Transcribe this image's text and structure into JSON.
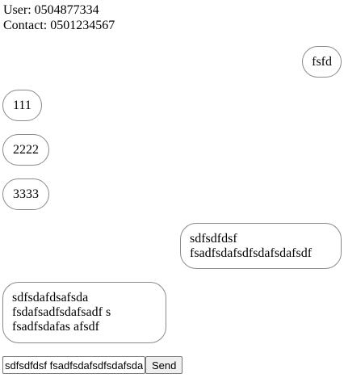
{
  "header": {
    "user_line": "User: 0504877334",
    "contact_line": "Contact: 0501234567"
  },
  "messages": [
    {
      "side": "right",
      "lines": [
        "fsfd"
      ]
    },
    {
      "side": "left",
      "lines": [
        "111"
      ]
    },
    {
      "side": "left",
      "lines": [
        "2222"
      ]
    },
    {
      "side": "left",
      "lines": [
        "3333"
      ]
    },
    {
      "side": "right",
      "lines": [
        "sdfsdfdsf",
        "fsadfsdafsdfsdafsdafsdf"
      ]
    },
    {
      "side": "left",
      "lines": [
        "sdfsdafdsafsda",
        "fsdafsadfsdafsadf s",
        "fsadfsdafas afsdf"
      ]
    }
  ],
  "composer": {
    "input_value": "sdfsdfdsf fsadfsdafsdfsdafsdafsdf",
    "send_label": "Send"
  }
}
